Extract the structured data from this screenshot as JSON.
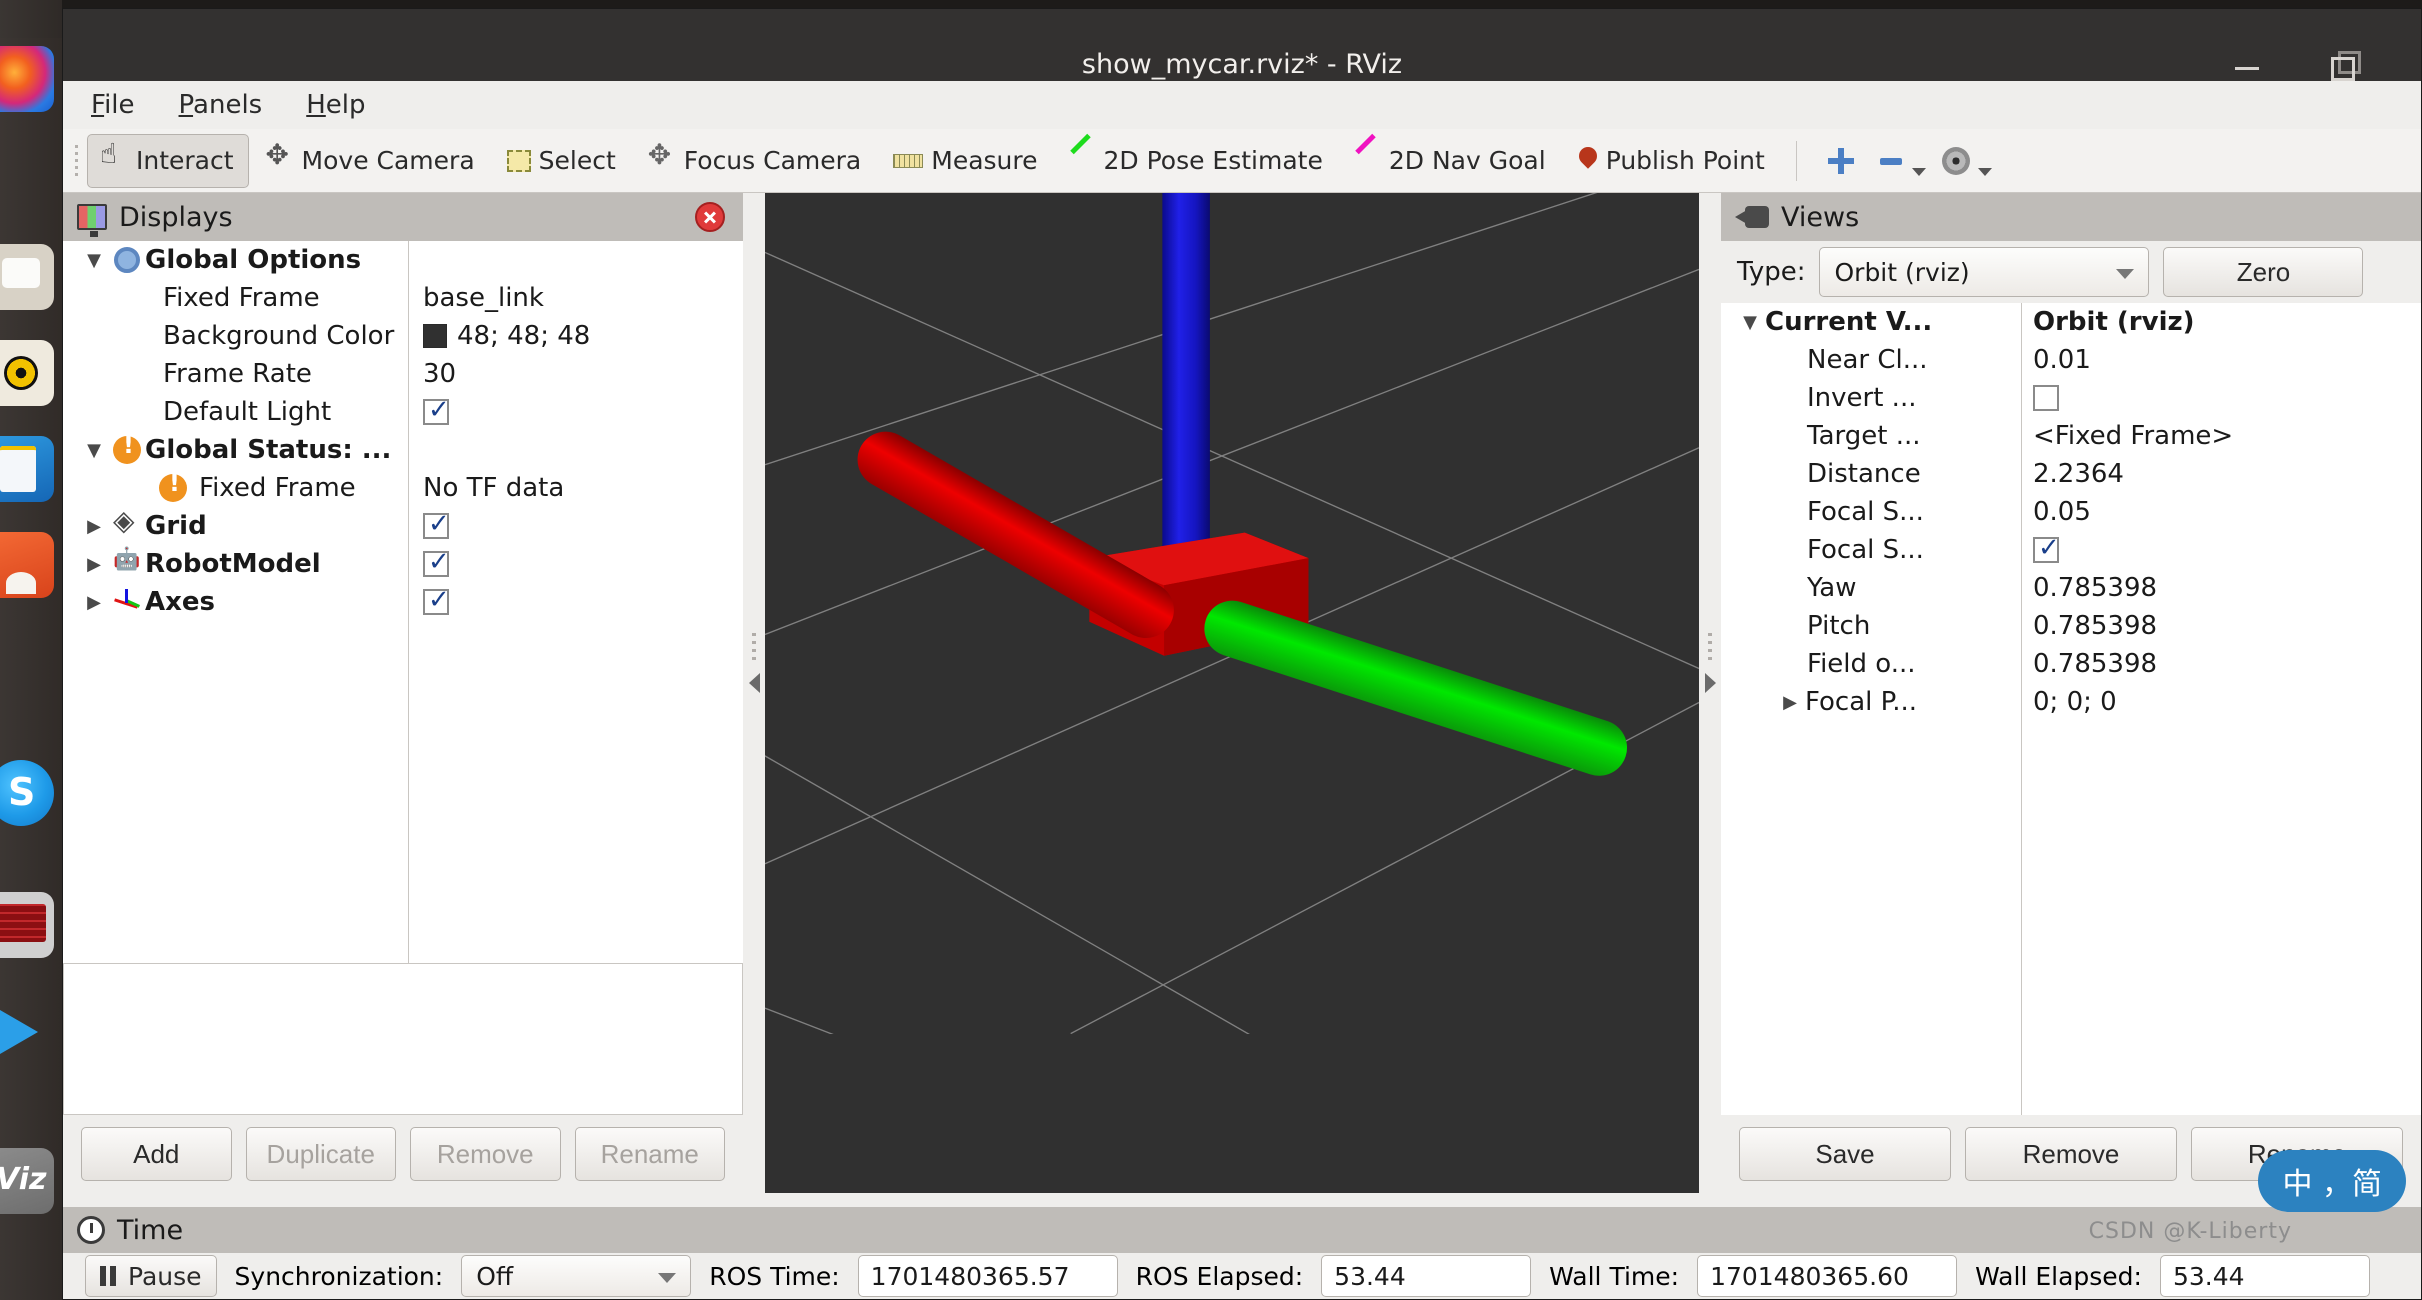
{
  "window": {
    "title": "show_mycar.rviz* - RViz",
    "minimize_icon": "minimize-icon",
    "maximize_icon": "maximize-icon"
  },
  "menubar": {
    "items": [
      {
        "label": "File",
        "mnemonic": "F"
      },
      {
        "label": "Panels",
        "mnemonic": "P"
      },
      {
        "label": "Help",
        "mnemonic": "H"
      }
    ]
  },
  "toolbar": {
    "buttons": [
      {
        "label": "Interact",
        "icon": "hand-pointer-icon",
        "active": true
      },
      {
        "label": "Move Camera",
        "icon": "move-camera-icon",
        "active": false
      },
      {
        "label": "Select",
        "icon": "select-rectangle-icon",
        "active": false
      },
      {
        "label": "Focus Camera",
        "icon": "focus-camera-icon",
        "active": false
      },
      {
        "label": "Measure",
        "icon": "ruler-icon",
        "active": false
      },
      {
        "label": "2D Pose Estimate",
        "icon": "green-arrow-icon",
        "active": false
      },
      {
        "label": "2D Nav Goal",
        "icon": "magenta-arrow-icon",
        "active": false
      },
      {
        "label": "Publish Point",
        "icon": "map-pin-icon",
        "active": false
      }
    ],
    "extra_icons": [
      "plus-icon",
      "minus-icon",
      "eye-icon"
    ]
  },
  "displays_panel": {
    "title": "Displays",
    "icon": "displays-icon",
    "close_icon": "close-icon",
    "rows": [
      {
        "label": "Global Options",
        "value": "",
        "indent": 0,
        "twisty": "down",
        "icon": "gear-icon",
        "style": "bold-dark",
        "kind": "group"
      },
      {
        "label": "Fixed Frame",
        "value": "base_link",
        "indent": 1,
        "twisty": "",
        "icon": "",
        "style": "plain",
        "kind": "text"
      },
      {
        "label": "Background Color",
        "value": "48; 48; 48",
        "indent": 1,
        "twisty": "",
        "icon": "",
        "style": "plain",
        "kind": "color"
      },
      {
        "label": "Frame Rate",
        "value": "30",
        "indent": 1,
        "twisty": "",
        "icon": "",
        "style": "plain",
        "kind": "text"
      },
      {
        "label": "Default Light",
        "value": "",
        "indent": 1,
        "twisty": "",
        "icon": "",
        "style": "plain",
        "kind": "checkbox",
        "checked": true
      },
      {
        "label": "Global Status: ...",
        "value": "",
        "indent": 0,
        "twisty": "down",
        "icon": "warning-icon",
        "style": "orange-bold",
        "kind": "group"
      },
      {
        "label": "Fixed Frame",
        "value": "No TF data",
        "indent": 1,
        "twisty": "",
        "icon": "warning-icon",
        "style": "orange",
        "kind": "text"
      },
      {
        "label": "Grid",
        "value": "",
        "indent": 0,
        "twisty": "right",
        "icon": "grid-icon",
        "style": "blue-bold",
        "kind": "checkbox",
        "checked": true
      },
      {
        "label": "RobotModel",
        "value": "",
        "indent": 0,
        "twisty": "right",
        "icon": "robot-icon",
        "style": "blue-bold",
        "kind": "checkbox",
        "checked": true
      },
      {
        "label": "Axes",
        "value": "",
        "indent": 0,
        "twisty": "right",
        "icon": "axes-icon",
        "style": "blue-bold",
        "kind": "checkbox",
        "checked": true
      }
    ],
    "buttons": [
      {
        "label": "Add",
        "enabled": true
      },
      {
        "label": "Duplicate",
        "enabled": false
      },
      {
        "label": "Remove",
        "enabled": false
      },
      {
        "label": "Rename",
        "enabled": false
      }
    ]
  },
  "views_panel": {
    "title": "Views",
    "icon": "views-icon",
    "type_label": "Type:",
    "type_value": "Orbit (rviz)",
    "zero_button": "Zero",
    "rows": [
      {
        "label": "Current V...",
        "value": "Orbit (rviz)",
        "indent": 0,
        "twisty": "down",
        "style": "bold",
        "kind": "text"
      },
      {
        "label": "Near Cl...",
        "value": "0.01",
        "indent": 1,
        "twisty": "",
        "style": "plain",
        "kind": "text"
      },
      {
        "label": "Invert ...",
        "value": "",
        "indent": 1,
        "twisty": "",
        "style": "plain",
        "kind": "checkbox",
        "checked": false
      },
      {
        "label": "Target ...",
        "value": "<Fixed Frame>",
        "indent": 1,
        "twisty": "",
        "style": "plain",
        "kind": "text"
      },
      {
        "label": "Distance",
        "value": "2.2364",
        "indent": 1,
        "twisty": "",
        "style": "plain",
        "kind": "text"
      },
      {
        "label": "Focal S...",
        "value": "0.05",
        "indent": 1,
        "twisty": "",
        "style": "plain",
        "kind": "text"
      },
      {
        "label": "Focal S...",
        "value": "",
        "indent": 1,
        "twisty": "",
        "style": "plain",
        "kind": "checkbox",
        "checked": true
      },
      {
        "label": "Yaw",
        "value": "0.785398",
        "indent": 1,
        "twisty": "",
        "style": "plain",
        "kind": "text"
      },
      {
        "label": "Pitch",
        "value": "0.785398",
        "indent": 1,
        "twisty": "",
        "style": "plain",
        "kind": "text"
      },
      {
        "label": "Field o...",
        "value": "0.785398",
        "indent": 1,
        "twisty": "",
        "style": "plain",
        "kind": "text"
      },
      {
        "label": "Focal P...",
        "value": "0; 0; 0",
        "indent": 1,
        "twisty": "right",
        "style": "plain",
        "kind": "text"
      }
    ],
    "buttons": [
      {
        "label": "Save",
        "enabled": true
      },
      {
        "label": "Remove",
        "enabled": true
      },
      {
        "label": "Rename",
        "enabled": true
      }
    ]
  },
  "time_panel": {
    "title": "Time",
    "icon": "clock-icon",
    "pause_label": "Pause",
    "sync_label": "Synchronization:",
    "sync_value": "Off",
    "ros_time_label": "ROS Time:",
    "ros_time_value": "1701480365.57",
    "ros_elapsed_label": "ROS Elapsed:",
    "ros_elapsed_value": "53.44",
    "wall_time_label": "Wall Time:",
    "wall_time_value": "1701480365.60",
    "wall_elapsed_label": "Wall Elapsed:",
    "wall_elapsed_value": "53.44"
  },
  "view3d": {
    "background_color": "#303030",
    "grid_color": "#9a9a9a",
    "axes": [
      {
        "name": "x-axis",
        "color": "#e00000"
      },
      {
        "name": "y-axis",
        "color": "#00d000"
      },
      {
        "name": "z-axis",
        "color": "#1010d8"
      }
    ],
    "body_color": "#cc0000"
  },
  "ime": {
    "text": "中 ，简"
  },
  "watermark": {
    "text": "CSDN @K-Liberty"
  },
  "dock": {
    "items": [
      {
        "name": "firefox-icon"
      },
      {
        "name": "files-icon"
      },
      {
        "name": "rhythmbox-icon"
      },
      {
        "name": "writer-icon"
      },
      {
        "name": "software-icon"
      },
      {
        "name": "skype-icon"
      },
      {
        "name": "terminal-icon"
      },
      {
        "name": "vscode-icon"
      },
      {
        "name": "rviz-icon"
      }
    ]
  }
}
